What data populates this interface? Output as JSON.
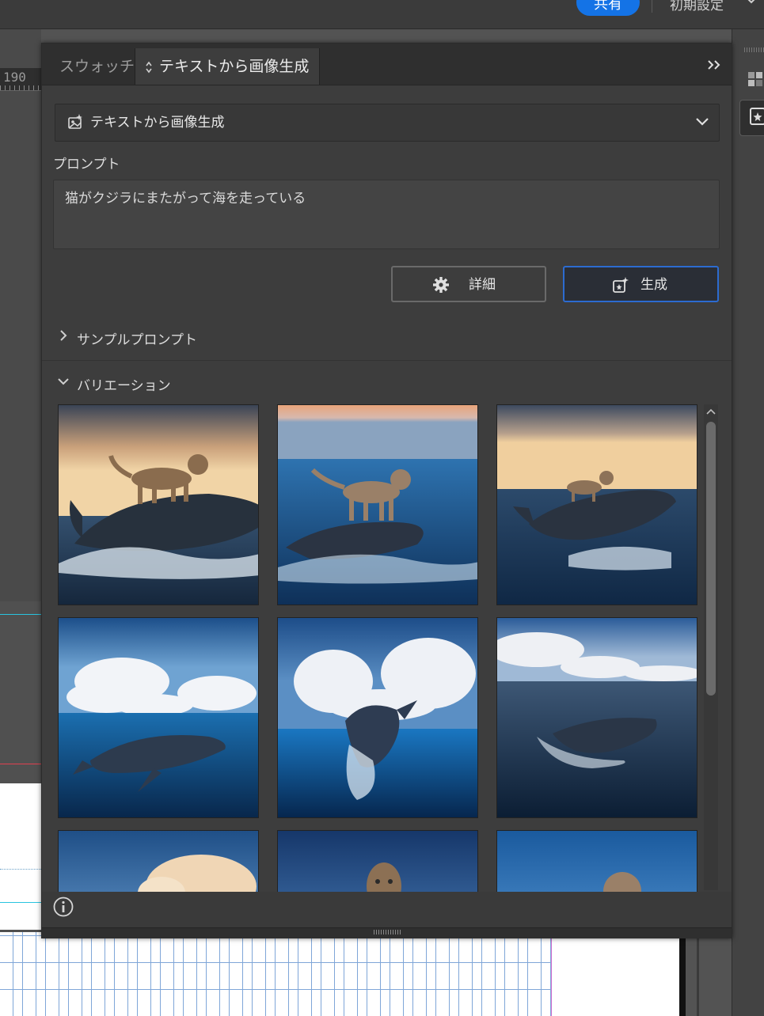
{
  "topbar": {
    "share_label": "共有",
    "workspace_label": "初期設定"
  },
  "ruler": {
    "number": "190"
  },
  "panel": {
    "tabs": [
      {
        "label": "スウォッチ",
        "active": false
      },
      {
        "label": "テキストから画像生成",
        "active": true
      }
    ],
    "mode_dropdown": {
      "label": "テキストから画像生成",
      "icon": "text-to-image-icon"
    },
    "prompt": {
      "label": "プロンプト",
      "value": "猫がクジラにまたがって海を走っている"
    },
    "buttons": {
      "detail": {
        "label": "詳細",
        "icon": "gear-icon"
      },
      "generate": {
        "label": "生成",
        "icon": "generate-sparkle-icon"
      }
    },
    "sections": {
      "sample_prompts": {
        "label": "サンプルプロンプト",
        "expanded": false
      },
      "variations": {
        "label": "バリエーション",
        "expanded": true
      }
    }
  },
  "colors": {
    "accent": "#1473e6",
    "panel_bg": "#3d3d3d",
    "tab_bar_bg": "#2f2f2f",
    "generate_border": "#2c6bd0"
  }
}
